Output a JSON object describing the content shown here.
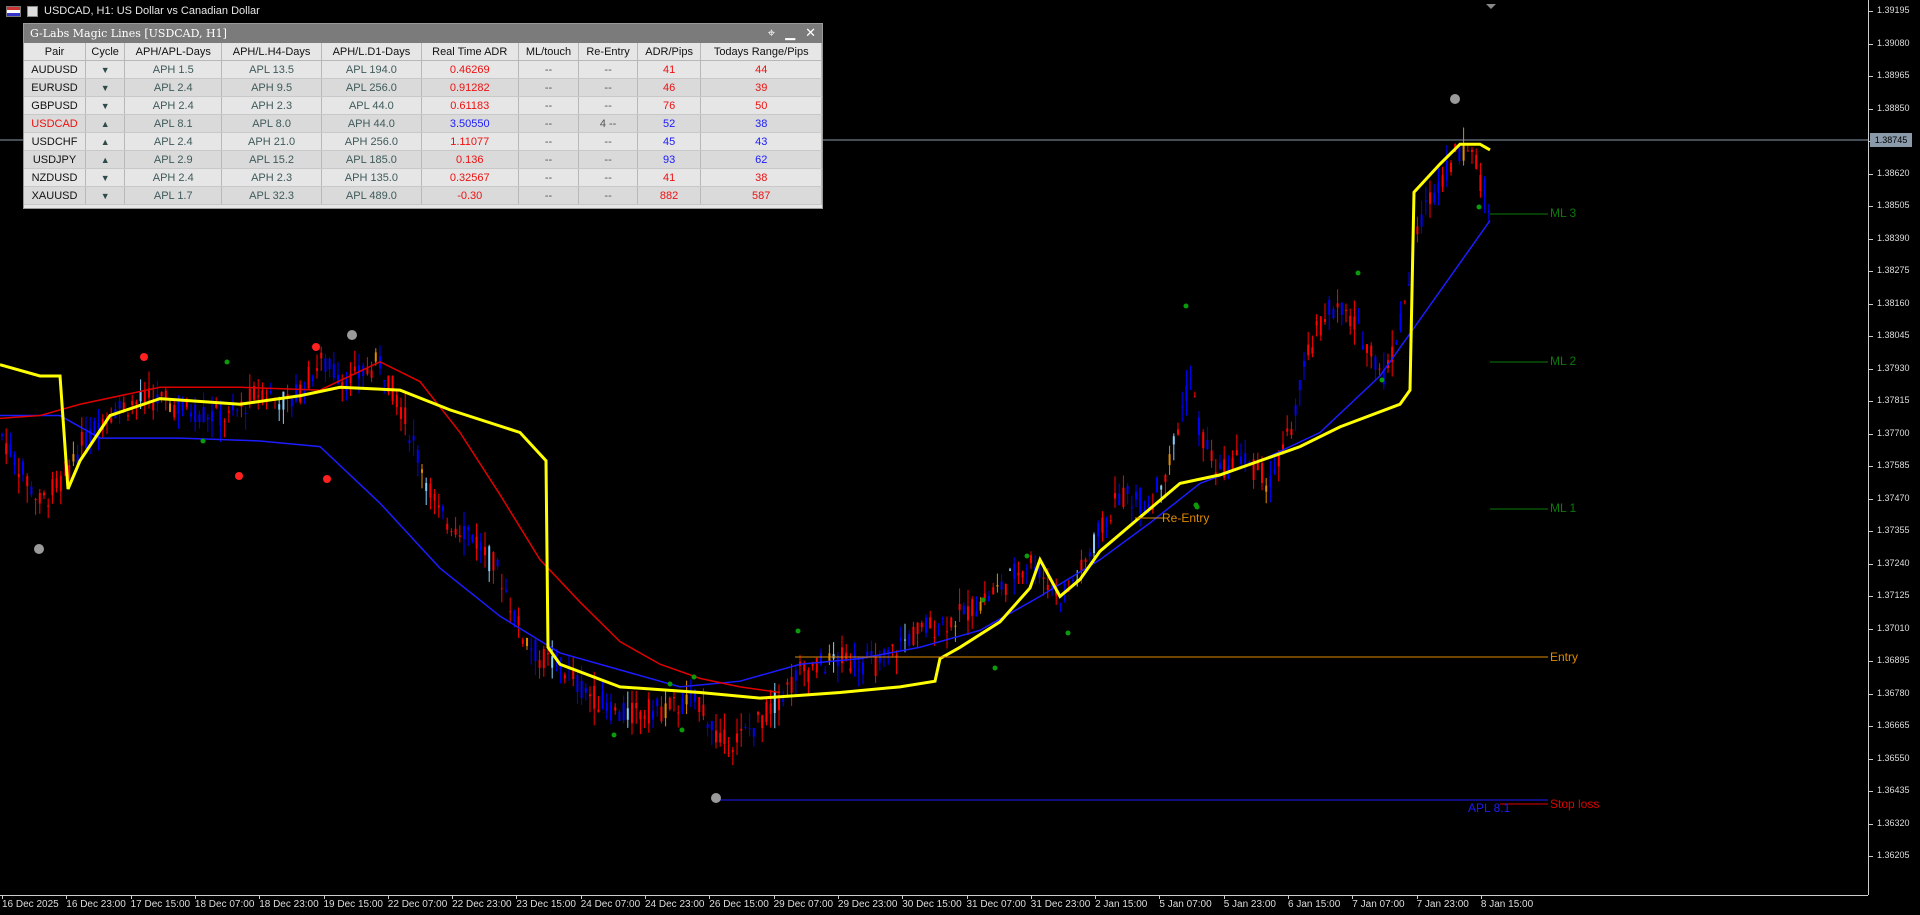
{
  "window": {
    "title": "USDCAD, H1:  US Dollar vs Canadian Dollar"
  },
  "panel": {
    "title": "G-Labs Magic Lines [USDCAD, H1]",
    "columns": [
      "Pair",
      "Cycle",
      "APH/APL-Days",
      "APH/L.H4-Days",
      "APH/L.D1-Days",
      "Real Time ADR",
      "ML/touch",
      "Re-Entry",
      "ADR/Pips",
      "Todays Range/Pips"
    ],
    "active_pair": "USDCAD",
    "rows": [
      {
        "pair": "AUDUSD",
        "cycle": "down",
        "h1": "APH 1.5",
        "h4": "APL 13.5",
        "d1": "APL 194.0",
        "adr": "0.46269",
        "adr_color": "red",
        "touch": "--",
        "reentry": "--",
        "adr_pips": "41",
        "pips_color": "red",
        "range": "44",
        "range_color": "red"
      },
      {
        "pair": "EURUSD",
        "cycle": "down",
        "h1": "APL 2.4",
        "h4": "APH 9.5",
        "d1": "APL 256.0",
        "adr": "0.91282",
        "adr_color": "red",
        "touch": "--",
        "reentry": "--",
        "adr_pips": "46",
        "pips_color": "red",
        "range": "39",
        "range_color": "red"
      },
      {
        "pair": "GBPUSD",
        "cycle": "down",
        "h1": "APH 2.4",
        "h4": "APH 2.3",
        "d1": "APL 44.0",
        "adr": "0.61183",
        "adr_color": "red",
        "touch": "--",
        "reentry": "--",
        "adr_pips": "76",
        "pips_color": "red",
        "range": "50",
        "range_color": "red"
      },
      {
        "pair": "USDCAD",
        "cycle": "up",
        "h1": "APL 8.1",
        "h4": "APL 8.0",
        "d1": "APH 44.0",
        "adr": "3.50550",
        "adr_color": "blue",
        "touch": "--",
        "reentry": "4 --",
        "adr_pips": "52",
        "pips_color": "blue",
        "range": "38",
        "range_color": "blue"
      },
      {
        "pair": "USDCHF",
        "cycle": "up",
        "h1": "APL 2.4",
        "h4": "APH 21.0",
        "d1": "APH 256.0",
        "adr": "1.11077",
        "adr_color": "red",
        "touch": "--",
        "reentry": "--",
        "adr_pips": "45",
        "pips_color": "blue",
        "range": "43",
        "range_color": "blue"
      },
      {
        "pair": "USDJPY",
        "cycle": "up",
        "h1": "APL 2.9",
        "h4": "APL 15.2",
        "d1": "APL 185.0",
        "adr": "0.136",
        "adr_color": "red",
        "touch": "--",
        "reentry": "--",
        "adr_pips": "93",
        "pips_color": "blue",
        "range": "62",
        "range_color": "blue"
      },
      {
        "pair": "NZDUSD",
        "cycle": "down",
        "h1": "APH 2.4",
        "h4": "APH 2.3",
        "d1": "APH 135.0",
        "adr": "0.32567",
        "adr_color": "red",
        "touch": "--",
        "reentry": "--",
        "adr_pips": "41",
        "pips_color": "red",
        "range": "38",
        "range_color": "red"
      },
      {
        "pair": "XAUUSD",
        "cycle": "down",
        "h1": "APL 1.7",
        "h4": "APL 32.3",
        "d1": "APL 489.0",
        "adr": "-0.30",
        "adr_color": "red",
        "touch": "--",
        "reentry": "--",
        "adr_pips": "882",
        "pips_color": "red",
        "range": "587",
        "range_color": "red"
      }
    ]
  },
  "price_axis": {
    "ticks": [
      "1.39195",
      "1.39080",
      "1.38965",
      "1.38850",
      "1.38735",
      "1.38620",
      "1.38505",
      "1.38390",
      "1.38275",
      "1.38160",
      "1.38045",
      "1.37930",
      "1.37815",
      "1.37700",
      "1.37585",
      "1.37470",
      "1.37355",
      "1.37240",
      "1.37125",
      "1.37010",
      "1.36895",
      "1.36780",
      "1.36665",
      "1.36550",
      "1.36435",
      "1.36320",
      "1.36205"
    ],
    "current_price": "1.38745"
  },
  "time_axis": {
    "ticks": [
      "16 Dec 2025",
      "16 Dec 23:00",
      "17 Dec 15:00",
      "18 Dec 07:00",
      "18 Dec 23:00",
      "19 Dec 15:00",
      "22 Dec 07:00",
      "22 Dec 23:00",
      "23 Dec 15:00",
      "24 Dec 07:00",
      "24 Dec 23:00",
      "26 Dec 15:00",
      "29 Dec 07:00",
      "29 Dec 23:00",
      "30 Dec 15:00",
      "31 Dec 07:00",
      "31 Dec 23:00",
      "2 Jan 15:00",
      "5 Jan 07:00",
      "5 Jan 23:00",
      "6 Jan 15:00",
      "7 Jan 07:00",
      "7 Jan 23:00",
      "8 Jan 15:00"
    ]
  },
  "levels": {
    "ml3": "ML 3",
    "ml2": "ML 2",
    "ml1": "ML 1",
    "entry": "Entry",
    "reentry": "Re-Entry",
    "stop_loss": "Stop loss",
    "apl_label": "APL 8.1"
  },
  "colors": {
    "bull": "#0000ff",
    "bear": "#ff0000",
    "highlight": "#87cefa",
    "ma_yellow": "#ffff00",
    "ma_red": "#e00000",
    "ma_blue": "#1c1cff",
    "level_green": "#0a7a0a",
    "entry_orange": "#e08a00",
    "stop_red": "#e00000"
  }
}
